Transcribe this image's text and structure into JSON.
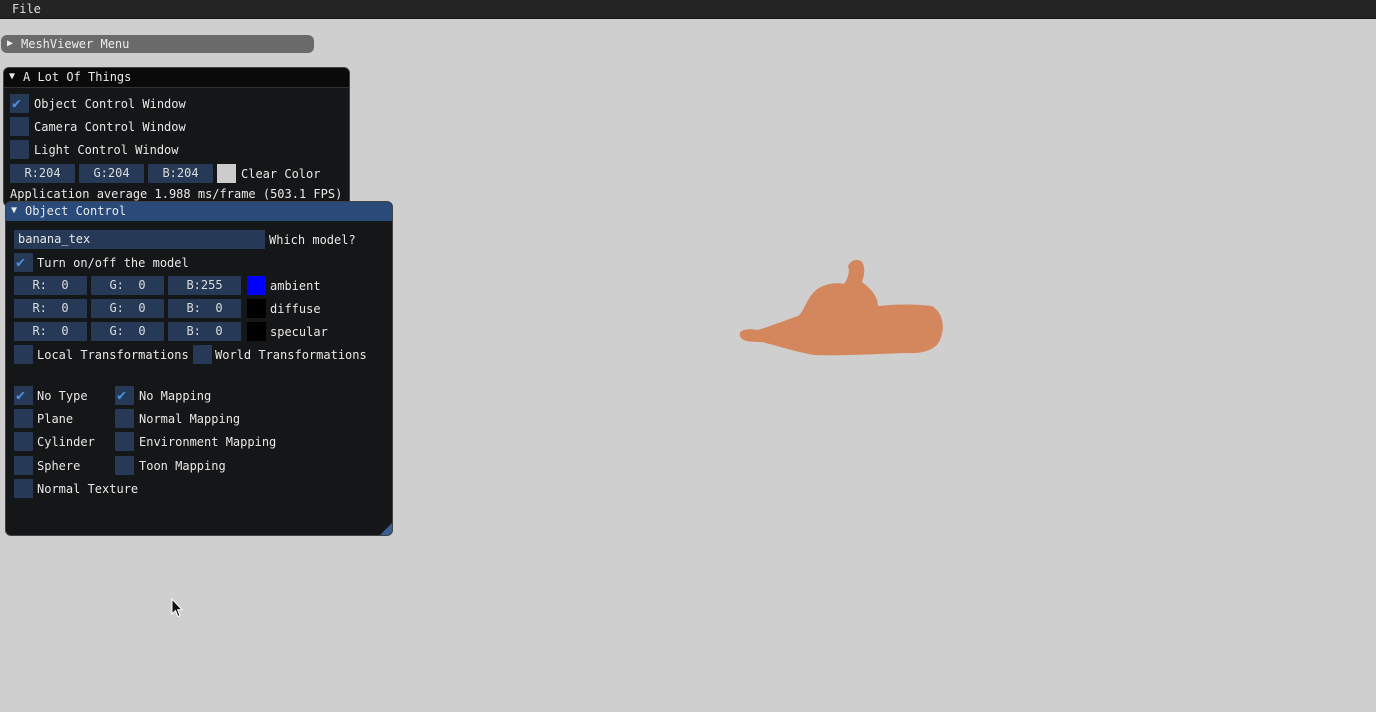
{
  "menubar": {
    "file_label": "File"
  },
  "meshviewer_menu": {
    "title": "MeshViewer Menu"
  },
  "a_lot_of_things": {
    "title": "A Lot Of Things",
    "checkboxes": [
      {
        "label": "Object Control Window",
        "checked": true
      },
      {
        "label": "Camera Control Window",
        "checked": false
      },
      {
        "label": "Light Control Window",
        "checked": false
      }
    ],
    "clear_color": {
      "r": "R:204",
      "g": "G:204",
      "b": "B:204",
      "label": "Clear Color",
      "swatch": "#cccccc"
    },
    "fps_text": "Application average 1.988 ms/frame (503.1 FPS)"
  },
  "object_control": {
    "title": "Object Control",
    "model_input": "banana_tex",
    "model_label": "Which model?",
    "toggle_label": "Turn on/off the model",
    "toggle_checked": true,
    "colors": [
      {
        "r": "R:  0",
        "g": "G:  0",
        "b": "B:255",
        "label": "ambient",
        "swatch": "#0000ff"
      },
      {
        "r": "R:  0",
        "g": "G:  0",
        "b": "B:  0",
        "label": "diffuse",
        "swatch": "#000000"
      },
      {
        "r": "R:  0",
        "g": "G:  0",
        "b": "B:  0",
        "label": "specular",
        "swatch": "#000000"
      }
    ],
    "transforms": {
      "local": "Local Transformations",
      "world": "World Transformations"
    },
    "types": [
      {
        "label": "No Type",
        "checked": true
      },
      {
        "label": "Plane",
        "checked": false
      },
      {
        "label": "Cylinder",
        "checked": false
      },
      {
        "label": "Sphere",
        "checked": false
      },
      {
        "label": "Normal Texture",
        "checked": false
      }
    ],
    "mappings": [
      {
        "label": "No Mapping",
        "checked": true
      },
      {
        "label": "Normal Mapping",
        "checked": false
      },
      {
        "label": "Environment Mapping",
        "checked": false
      },
      {
        "label": "Toon Mapping",
        "checked": false
      }
    ]
  },
  "viewport": {
    "background": "#cfcfcf",
    "model_color": "#d4875c"
  }
}
